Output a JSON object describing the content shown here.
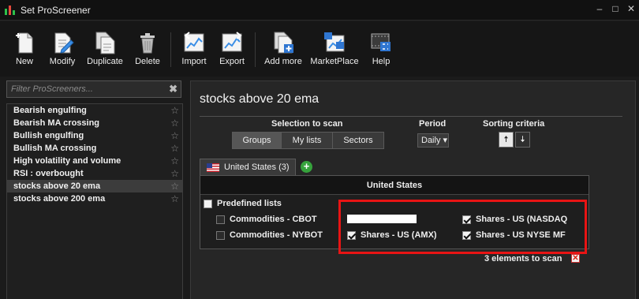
{
  "window": {
    "title": "Set ProScreener",
    "min_glyph": "–",
    "max_glyph": "□",
    "close_glyph": "✕"
  },
  "toolbar": {
    "new": "New",
    "modify": "Modify",
    "duplicate": "Duplicate",
    "delete": "Delete",
    "import": "Import",
    "export": "Export",
    "add_more": "Add more",
    "marketplace": "MarketPlace",
    "help": "Help"
  },
  "filter": {
    "placeholder": "Filter ProScreeners...",
    "value": "",
    "clear_glyph": "✖"
  },
  "screeners": [
    {
      "label": "Bearish engulfing",
      "star": "☆"
    },
    {
      "label": "Bearish MA crossing",
      "star": "☆"
    },
    {
      "label": "Bullish engulfing",
      "star": "☆"
    },
    {
      "label": "Bullish MA crossing",
      "star": "☆"
    },
    {
      "label": "High volatility and volume",
      "star": "☆"
    },
    {
      "label": "RSI : overbought",
      "star": "☆"
    },
    {
      "label": "stocks above 20 ema",
      "star": "☆"
    },
    {
      "label": "stocks above 200 ema",
      "star": "☆"
    }
  ],
  "main": {
    "title": "stocks above 20 ema",
    "selection_label": "Selection to scan",
    "scan_tabs": {
      "groups": "Groups",
      "my_lists": "My lists",
      "sectors": "Sectors"
    },
    "period_label": "Period",
    "period_value": "Daily ▾",
    "sorting_label": "Sorting criteria",
    "sort_up": "🠅",
    "sort_down": "🠇",
    "market_tab": "United States (3)",
    "add_tab": "+",
    "box_title": "United States",
    "predefined": "Predefined lists",
    "lists": {
      "commodities_cbot": "Commodities - CBOT",
      "commodities_nybot": "Commodities - NYBOT",
      "shares_amx": "Shares - US (AMX)",
      "shares_nasdaq": "Shares - US (NASDAQ",
      "shares_nyse_mf": "Shares - US NYSE MF"
    },
    "elements_count": "3 elements to scan",
    "clear_glyph": "✕"
  },
  "colors": {
    "highlight": "#e81414",
    "accent_green": "#36a33c"
  }
}
